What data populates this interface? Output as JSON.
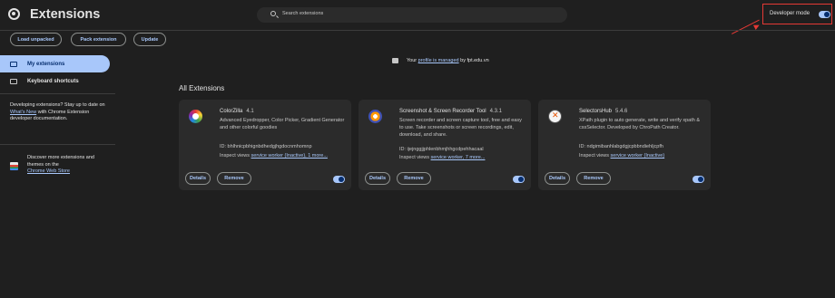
{
  "header": {
    "title": "Extensions",
    "search_placeholder": "Search extensions",
    "developer_mode_label": "Developer mode",
    "developer_mode_on": true
  },
  "toolbar": {
    "load_unpacked": "Load unpacked",
    "pack_extension": "Pack extension",
    "update": "Update"
  },
  "sidebar": {
    "my_extensions": "My extensions",
    "keyboard_shortcuts": "Keyboard shortcuts",
    "dev_promo_prefix": "Developing extensions? Stay up to date on ",
    "dev_promo_link": "What's New",
    "dev_promo_suffix": " with Chrome Extension developer documentation.",
    "store_text": "Discover more extensions and themes on the",
    "store_link": "Chrome Web Store"
  },
  "managed": {
    "prefix": "Your ",
    "link": "profile is managed",
    "suffix": " by fpt.edu.vn"
  },
  "section_title": "All Extensions",
  "extensions": [
    {
      "name": "ColorZilla",
      "version": "4.1",
      "description": "Advanced Eyedropper, Color Picker, Gradient Generator and other colorful goodies",
      "id": "ID: bhlhnicpbhignbdhedgjhgdocnmhomnp",
      "inspect_prefix": "Inspect views ",
      "inspect_link": "service worker (Inactive), 1 more...",
      "enabled": true
    },
    {
      "name": "Screenshot & Screen Recorder Tool",
      "version": "4.3.1",
      "description": "Screen recorder and screen capture tool, free and easy to use. Take screenshots or screen recordings, edit, download, and share.",
      "id": "ID: ijejnggjjphlenbhmjhhgcdpehhacaal",
      "inspect_prefix": "Inspect views ",
      "inspect_link": "service worker, 7 more...",
      "enabled": true
    },
    {
      "name": "SelectorsHub",
      "version": "5.4.6",
      "description": "XPath plugin to auto generate, write and verify xpath & cssSelector. Developed by ChroPath Creator.",
      "id": "ID: ndgimibanhlabgdgjcpbbndiehljcpfh",
      "inspect_prefix": "Inspect views ",
      "inspect_link": "service worker (Inactive)",
      "enabled": true
    }
  ],
  "card_buttons": {
    "details": "Details",
    "remove": "Remove"
  },
  "colors": {
    "background": "#1f1f1f",
    "card": "#2b2b2b",
    "accent": "#a8c7fa",
    "annotation": "#e53935"
  },
  "icons": [
    "chrome-logo-icon",
    "search-icon",
    "extension-icon",
    "keyboard-icon",
    "building-icon",
    "web-store-icon"
  ]
}
